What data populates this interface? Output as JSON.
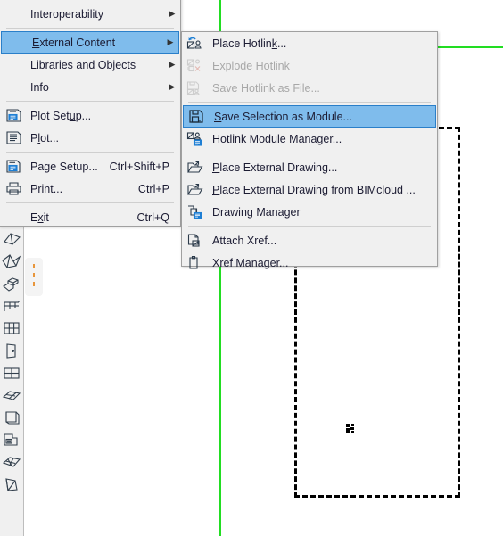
{
  "app": {
    "accent_selection": "#7fbcec",
    "accent_selection_border": "#2a7fc9",
    "menu_background": "#f0f0f0",
    "guide_color": "#22dd22",
    "hint_color": "#e8963c"
  },
  "canvas": {
    "name": "drawing-canvas",
    "marquee_label": "selection-marquee",
    "cursor_label": "marquee-cursor",
    "guides": [
      {
        "name": "vertical-guide",
        "orientation": "vertical"
      },
      {
        "name": "horizontal-guide",
        "orientation": "horizontal"
      }
    ]
  },
  "toolbar": {
    "name": "tool-palette",
    "tools": [
      {
        "icon": "roof-tool-icon",
        "label": "Roof"
      },
      {
        "icon": "shell-tool-icon",
        "label": "Shell"
      },
      {
        "icon": "stair-tool-icon",
        "label": "Stair"
      },
      {
        "icon": "railing-tool-icon",
        "label": "Railing"
      },
      {
        "icon": "curtain-wall-tool-icon",
        "label": "Curtain Wall"
      },
      {
        "icon": "door-tool-icon",
        "label": "Door"
      },
      {
        "icon": "window-tool-icon",
        "label": "Window"
      },
      {
        "icon": "skylight-tool-icon",
        "label": "Skylight"
      },
      {
        "icon": "object-tool-icon",
        "label": "Object"
      },
      {
        "icon": "zone-tool-icon",
        "label": "Zone"
      },
      {
        "icon": "mesh-tool-icon",
        "label": "Mesh"
      },
      {
        "icon": "morph-tool-icon",
        "label": "Morph"
      }
    ],
    "hover_hint": "dashed-hover-indicator"
  },
  "menu_main": {
    "name": "file-menu",
    "items": [
      {
        "type": "item",
        "label": "Interoperability",
        "accel": "",
        "icon": "",
        "submenu": true,
        "disabled": false,
        "selected": false,
        "mnemonic": ""
      },
      {
        "type": "separator"
      },
      {
        "type": "item",
        "label": "External Content",
        "accel": "",
        "icon": "",
        "submenu": true,
        "disabled": false,
        "selected": true,
        "mnemonic": "E"
      },
      {
        "type": "item",
        "label": "Libraries and Objects",
        "accel": "",
        "icon": "",
        "submenu": true,
        "disabled": false,
        "selected": false,
        "mnemonic": ""
      },
      {
        "type": "item",
        "label": "Info",
        "accel": "",
        "icon": "",
        "submenu": true,
        "disabled": false,
        "selected": false,
        "mnemonic": ""
      },
      {
        "type": "separator"
      },
      {
        "type": "item",
        "label": "Plot Setup...",
        "accel": "",
        "icon": "plot-setup-icon",
        "submenu": false,
        "disabled": false,
        "selected": false,
        "mnemonic": "u"
      },
      {
        "type": "item",
        "label": "Plot...",
        "accel": "",
        "icon": "plot-icon",
        "submenu": false,
        "disabled": false,
        "selected": false,
        "mnemonic": "l"
      },
      {
        "type": "separator"
      },
      {
        "type": "item",
        "label": "Page Setup...",
        "accel": "Ctrl+Shift+P",
        "icon": "page-setup-icon",
        "submenu": false,
        "disabled": false,
        "selected": false,
        "mnemonic": "g"
      },
      {
        "type": "item",
        "label": "Print...",
        "accel": "Ctrl+P",
        "icon": "print-icon",
        "submenu": false,
        "disabled": false,
        "selected": false,
        "mnemonic": "P"
      },
      {
        "type": "separator"
      },
      {
        "type": "item",
        "label": "Exit",
        "accel": "Ctrl+Q",
        "icon": "",
        "submenu": false,
        "disabled": false,
        "selected": false,
        "mnemonic": "x"
      }
    ]
  },
  "menu_sub": {
    "name": "external-content-submenu",
    "items": [
      {
        "type": "item",
        "label": "Place Hotlink...",
        "icon": "place-hotlink-icon",
        "disabled": false,
        "selected": false
      },
      {
        "type": "item",
        "label": "Explode Hotlink",
        "icon": "explode-hotlink-icon",
        "disabled": true,
        "selected": false
      },
      {
        "type": "item",
        "label": "Save Hotlink as File...",
        "icon": "save-hotlink-icon",
        "disabled": true,
        "selected": false
      },
      {
        "type": "separator"
      },
      {
        "type": "item",
        "label": "Save Selection as Module...",
        "icon": "save-module-icon",
        "disabled": false,
        "selected": true
      },
      {
        "type": "item",
        "label": "Hotlink Module Manager...",
        "icon": "hotlink-manager-icon",
        "disabled": false,
        "selected": false
      },
      {
        "type": "separator"
      },
      {
        "type": "item",
        "label": "Place External Drawing...",
        "icon": "place-external-drawing-icon",
        "disabled": false,
        "selected": false
      },
      {
        "type": "item",
        "label": "Place External Drawing from BIMcloud ...",
        "icon": "place-external-drawing-bimcloud-icon",
        "disabled": false,
        "selected": false
      },
      {
        "type": "item",
        "label": "Drawing Manager",
        "icon": "drawing-manager-icon",
        "disabled": false,
        "selected": false
      },
      {
        "type": "separator"
      },
      {
        "type": "item",
        "label": "Attach Xref...",
        "icon": "attach-xref-icon",
        "disabled": false,
        "selected": false
      },
      {
        "type": "item",
        "label": "Xref Manager...",
        "icon": "xref-manager-icon",
        "disabled": false,
        "selected": false
      }
    ]
  }
}
